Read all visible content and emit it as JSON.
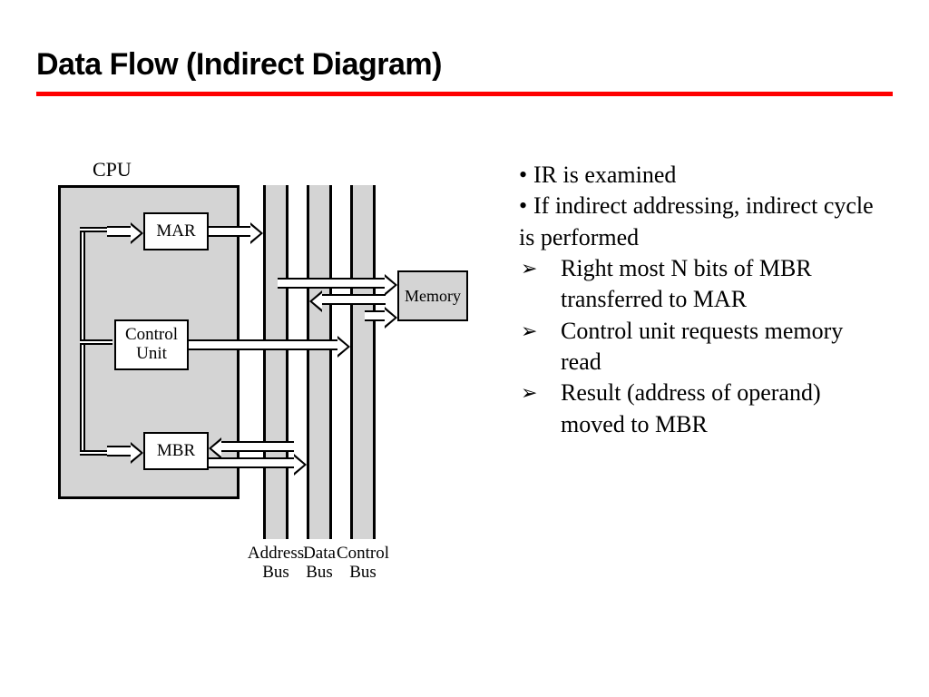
{
  "title": "Data Flow (Indirect Diagram)",
  "diagram": {
    "cpu_label": "CPU",
    "mar": "MAR",
    "cu_line1": "Control",
    "cu_line2": "Unit",
    "mbr": "MBR",
    "memory": "Memory",
    "bus1_line1": "Address",
    "bus1_line2": "Bus",
    "bus2_line1": "Data",
    "bus2_line2": "Bus",
    "bus3_line1": "Control",
    "bus3_line2": "Bus"
  },
  "notes": {
    "bullets": [
      "IR is examined",
      "If indirect addressing, indirect cycle is performed"
    ],
    "subs": [
      "Right most N bits of MBR transferred to MAR",
      "Control unit requests memory read",
      "Result (address of operand) moved to MBR"
    ]
  }
}
